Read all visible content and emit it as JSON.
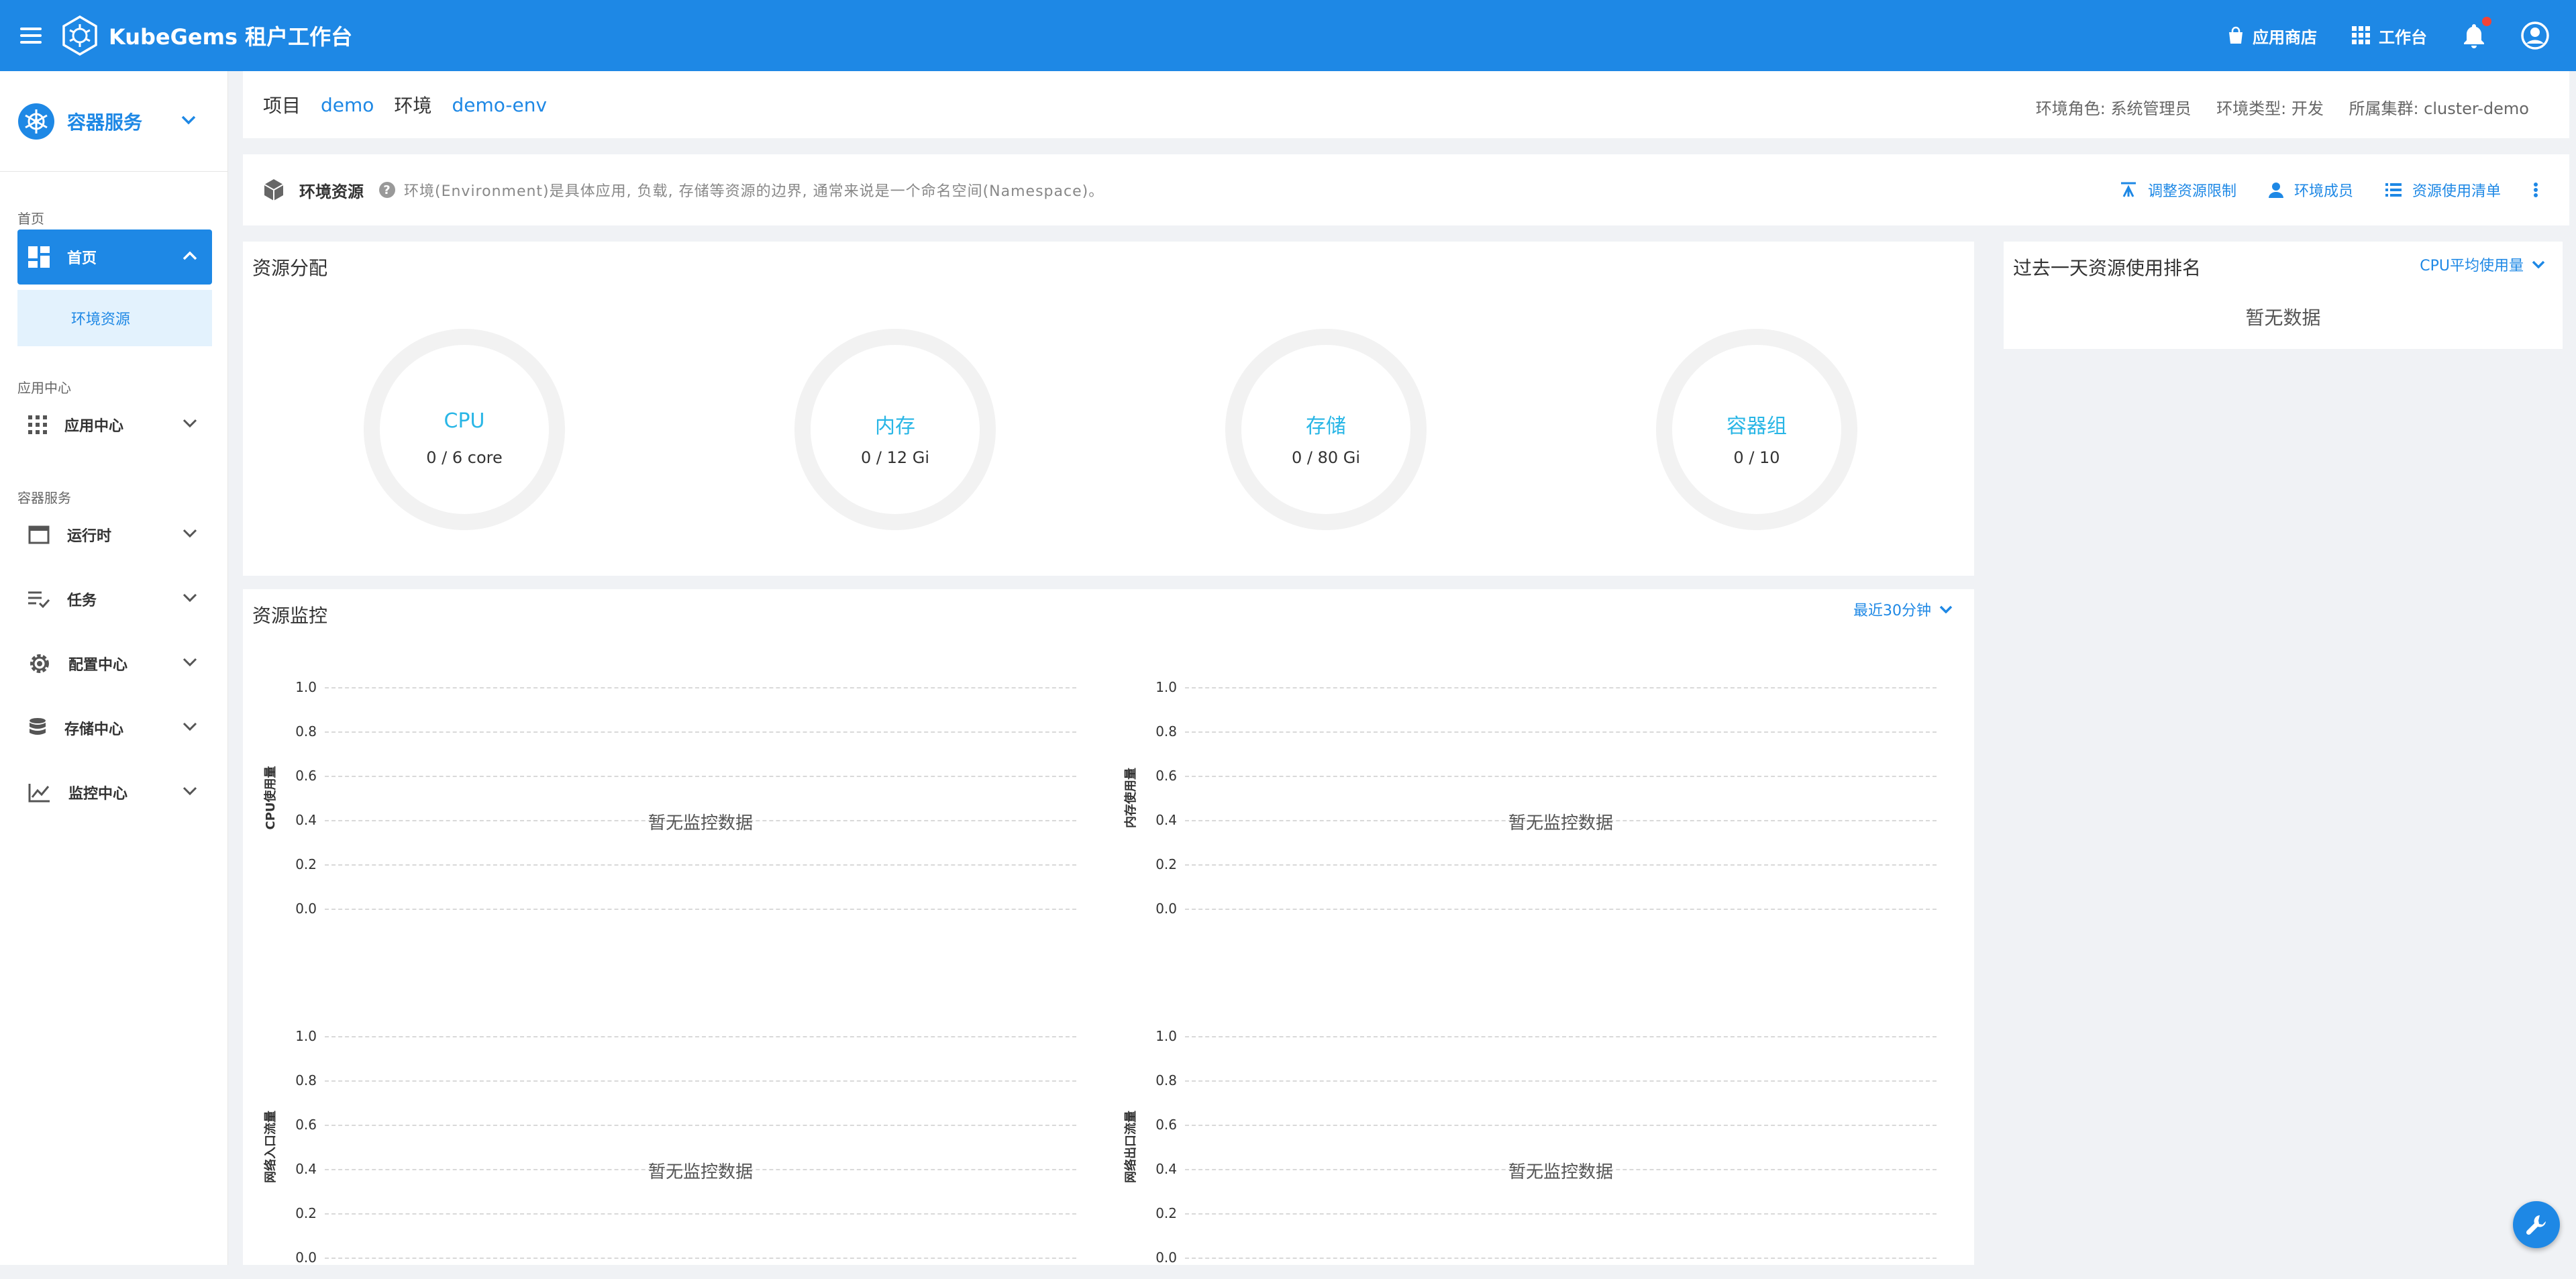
{
  "topbar": {
    "brand": "KubeGems 租户工作台",
    "app_store": "应用商店",
    "workbench": "工作台"
  },
  "sidebar": {
    "header_title": "容器服务",
    "groups": {
      "home": "首页",
      "app_center": "应用中心",
      "container_service": "容器服务"
    },
    "items": [
      {
        "label": "首页",
        "icon": "dashboard-icon",
        "active": true,
        "expanded": true
      },
      {
        "label": "应用中心",
        "icon": "apps-grid-icon"
      },
      {
        "label": "运行时",
        "icon": "window-icon"
      },
      {
        "label": "任务",
        "icon": "task-list-icon"
      },
      {
        "label": "配置中心",
        "icon": "gear-icon"
      },
      {
        "label": "存储中心",
        "icon": "database-icon"
      },
      {
        "label": "监控中心",
        "icon": "line-chart-icon"
      }
    ],
    "sub_items": [
      {
        "label": "环境资源"
      }
    ]
  },
  "breadcrumb": {
    "project_label": "项目",
    "project": "demo",
    "env_label": "环境",
    "env": "demo-env",
    "role": "环境角色: 系统管理员",
    "type": "环境类型: 开发",
    "cluster": "所属集群: cluster-demo"
  },
  "env_bar": {
    "title": "环境资源",
    "desc": "环境(Environment)是具体应用, 负载, 存储等资源的边界, 通常来说是一个命名空间(Namespace)。",
    "actions": [
      "调整资源限制",
      "环境成员",
      "资源使用清单"
    ]
  },
  "distribution": {
    "title": "资源分配",
    "gauges": [
      {
        "name": "CPU",
        "value": "0 / 6 core"
      },
      {
        "name": "内存",
        "value": "0 / 12 Gi"
      },
      {
        "name": "存储",
        "value": "0 / 80 Gi"
      },
      {
        "name": "容器组",
        "value": "0 / 10"
      }
    ]
  },
  "ranking": {
    "title": "过去一天资源使用排名",
    "filter": "CPU平均使用量",
    "empty": "暂无数据"
  },
  "monitor": {
    "title": "资源监控",
    "range": "最近30分钟",
    "empty": "暂无监控数据",
    "ticks": [
      "1.0",
      "0.8",
      "0.6",
      "0.4",
      "0.2",
      "0.0"
    ],
    "charts": [
      {
        "ylabel": "CPU使用量"
      },
      {
        "ylabel": "内存使用量"
      },
      {
        "ylabel": "网络入口流量"
      },
      {
        "ylabel": "网络出口流量"
      }
    ]
  },
  "colors": {
    "primary": "#1e88e5",
    "accent": "#29b6e6",
    "badge": "#f44336"
  }
}
